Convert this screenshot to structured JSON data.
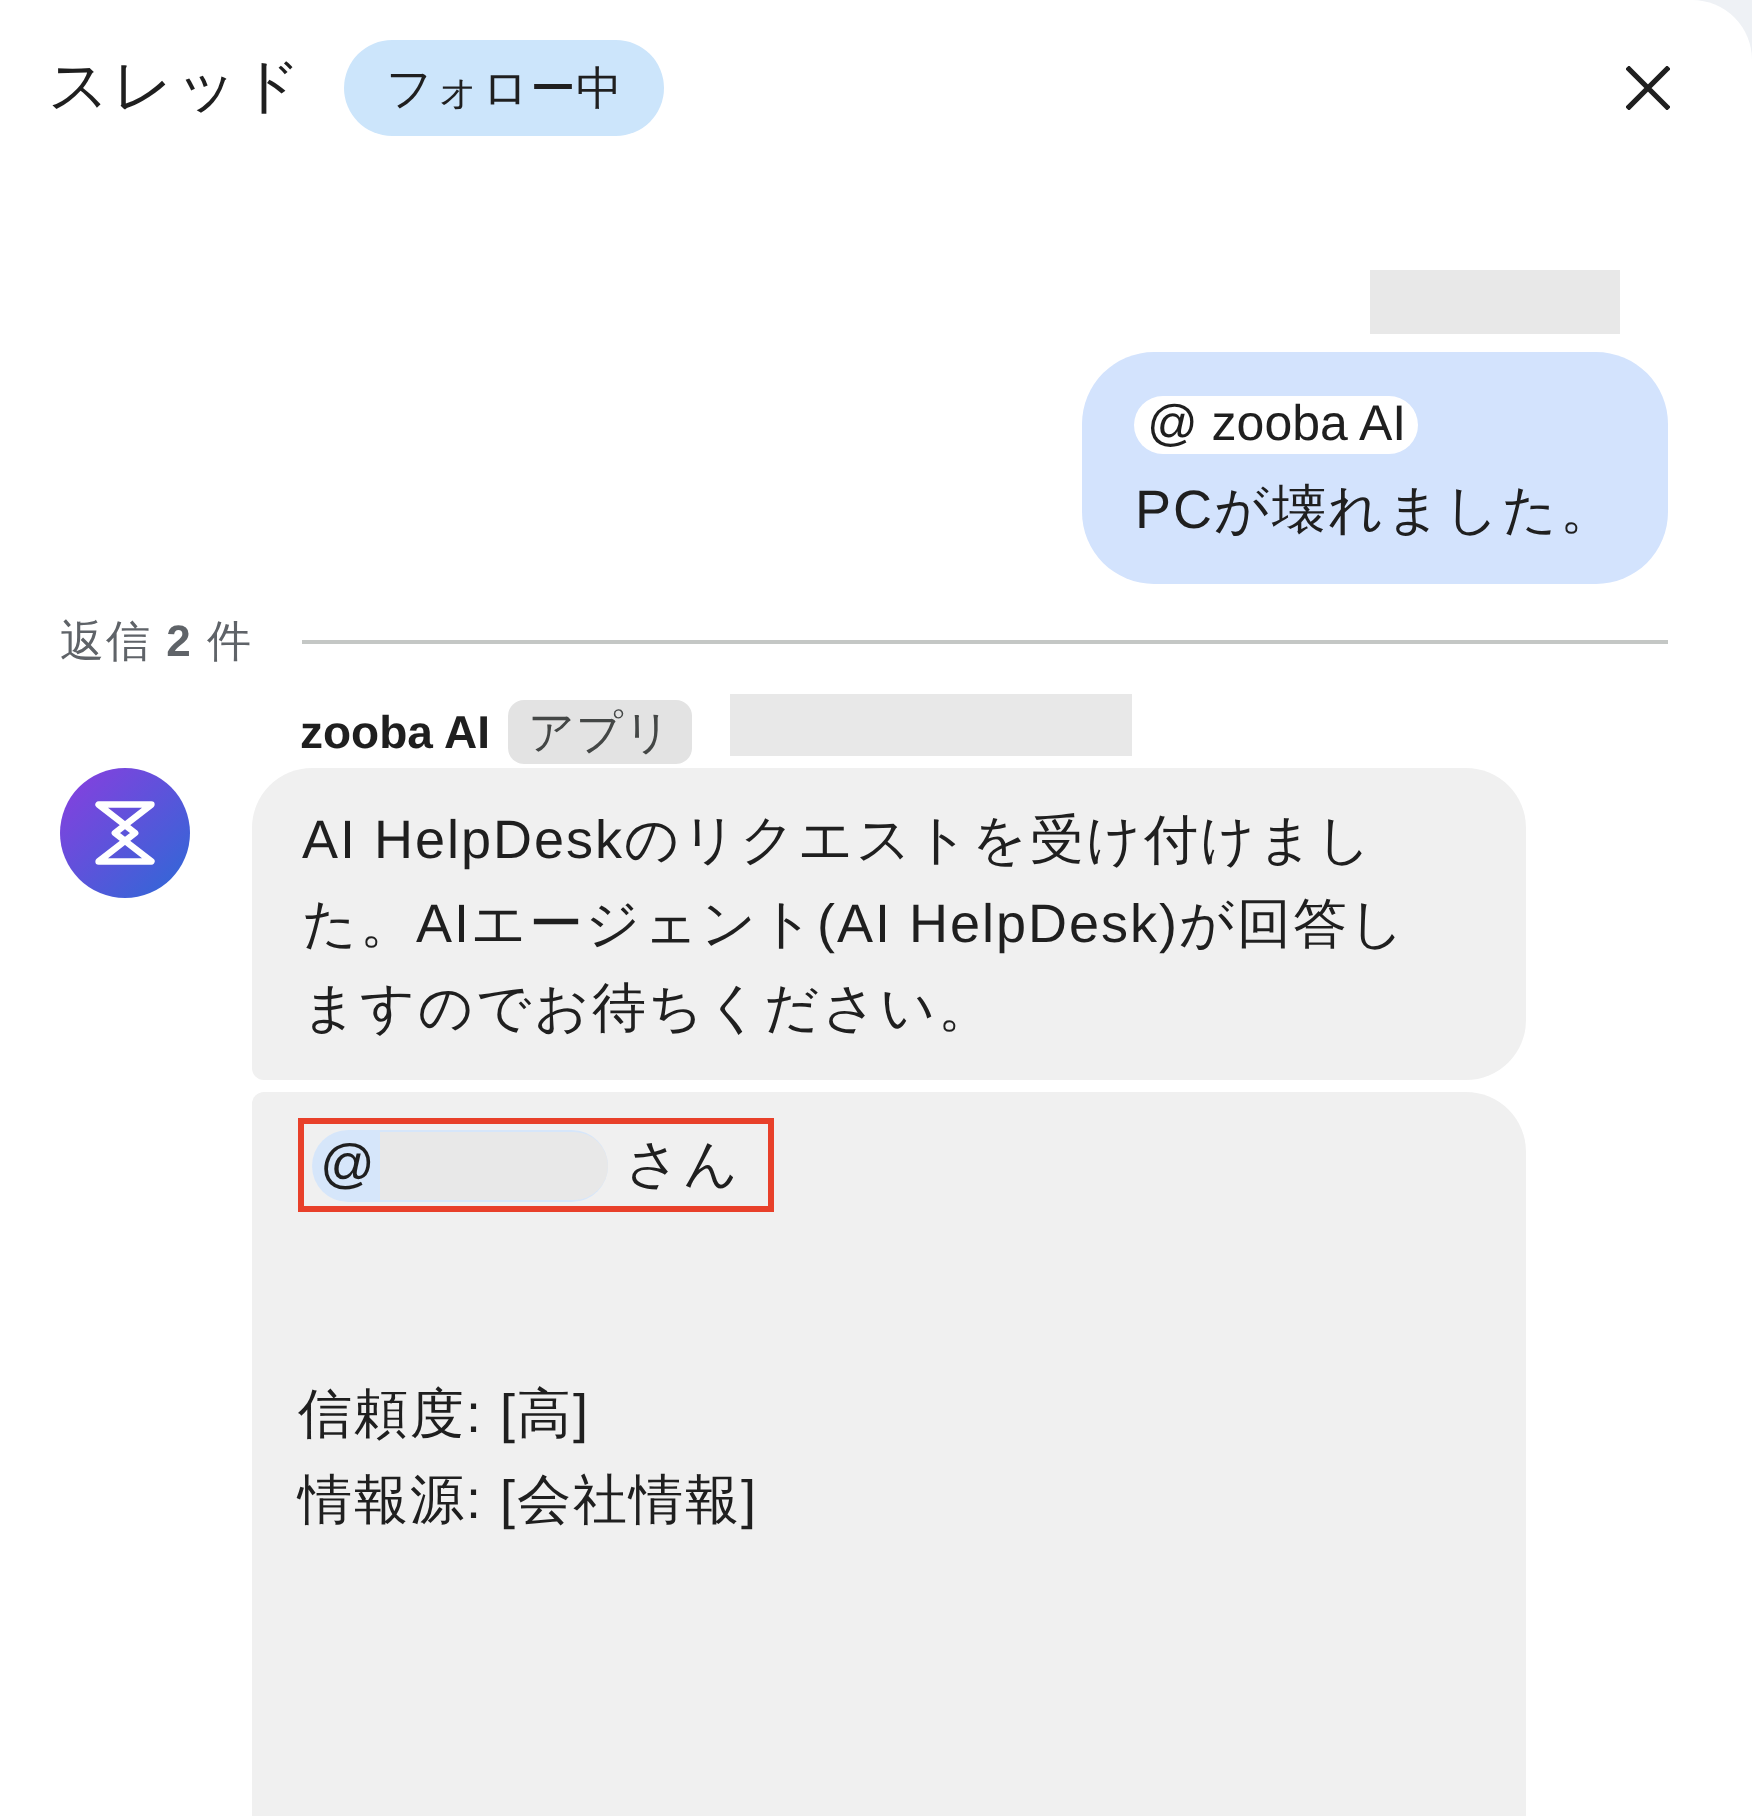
{
  "header": {
    "title": "スレッド",
    "follow_chip": "フォロー中"
  },
  "original_message": {
    "meta_redacted": true,
    "mention": "@ zooba AI",
    "text": "PCが壊れました。"
  },
  "replies_divider": "返信 **2** 件",
  "reply": {
    "sender": "zooba AI",
    "badge": "アプリ",
    "meta_redacted": true,
    "bubbles": [
      {
        "kind": "text",
        "text": "AI HelpDeskのリクエストを受け付けました。AIエージェント(AI HelpDesk)が回答しますのでお待ちください。"
      },
      {
        "kind": "mention",
        "mention_at": "@",
        "name_redacted": true,
        "suffix": "さん",
        "highlighted": true,
        "lines": [
          "信頼度: [高]",
          "情報源: [会社情報]"
        ]
      }
    ]
  }
}
